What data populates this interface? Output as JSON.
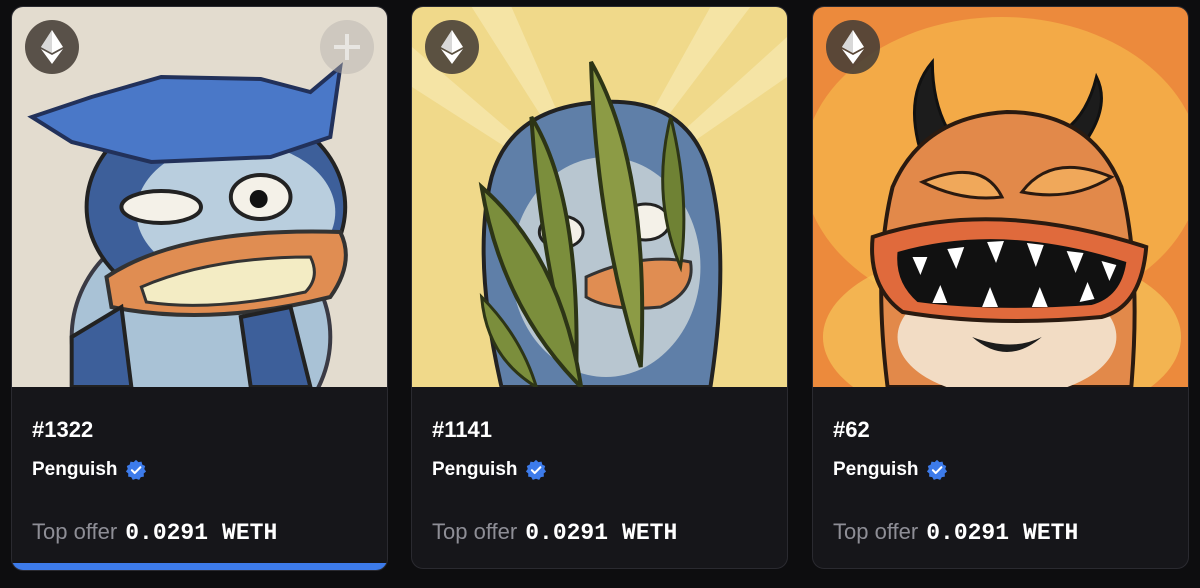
{
  "cards": [
    {
      "token_id": "#1322",
      "collection": "Penguish",
      "verified": true,
      "offer_label": "Top offer",
      "offer_value": "0.0291",
      "offer_currency": "WETH",
      "chain_icon": "ethereum-icon",
      "add_icon": "plus-icon",
      "selected": true
    },
    {
      "token_id": "#1141",
      "collection": "Penguish",
      "verified": true,
      "offer_label": "Top offer",
      "offer_value": "0.0291",
      "offer_currency": "WETH",
      "chain_icon": "ethereum-icon"
    },
    {
      "token_id": "#62",
      "collection": "Penguish",
      "verified": true,
      "offer_label": "Top offer",
      "offer_value": "0.0291",
      "offer_currency": "WETH",
      "chain_icon": "ethereum-icon"
    }
  ],
  "colors": {
    "background": "#0d0d0f",
    "card": "#16161a",
    "verified": "#3d7bea",
    "selected_bar": "#3d7bea"
  }
}
